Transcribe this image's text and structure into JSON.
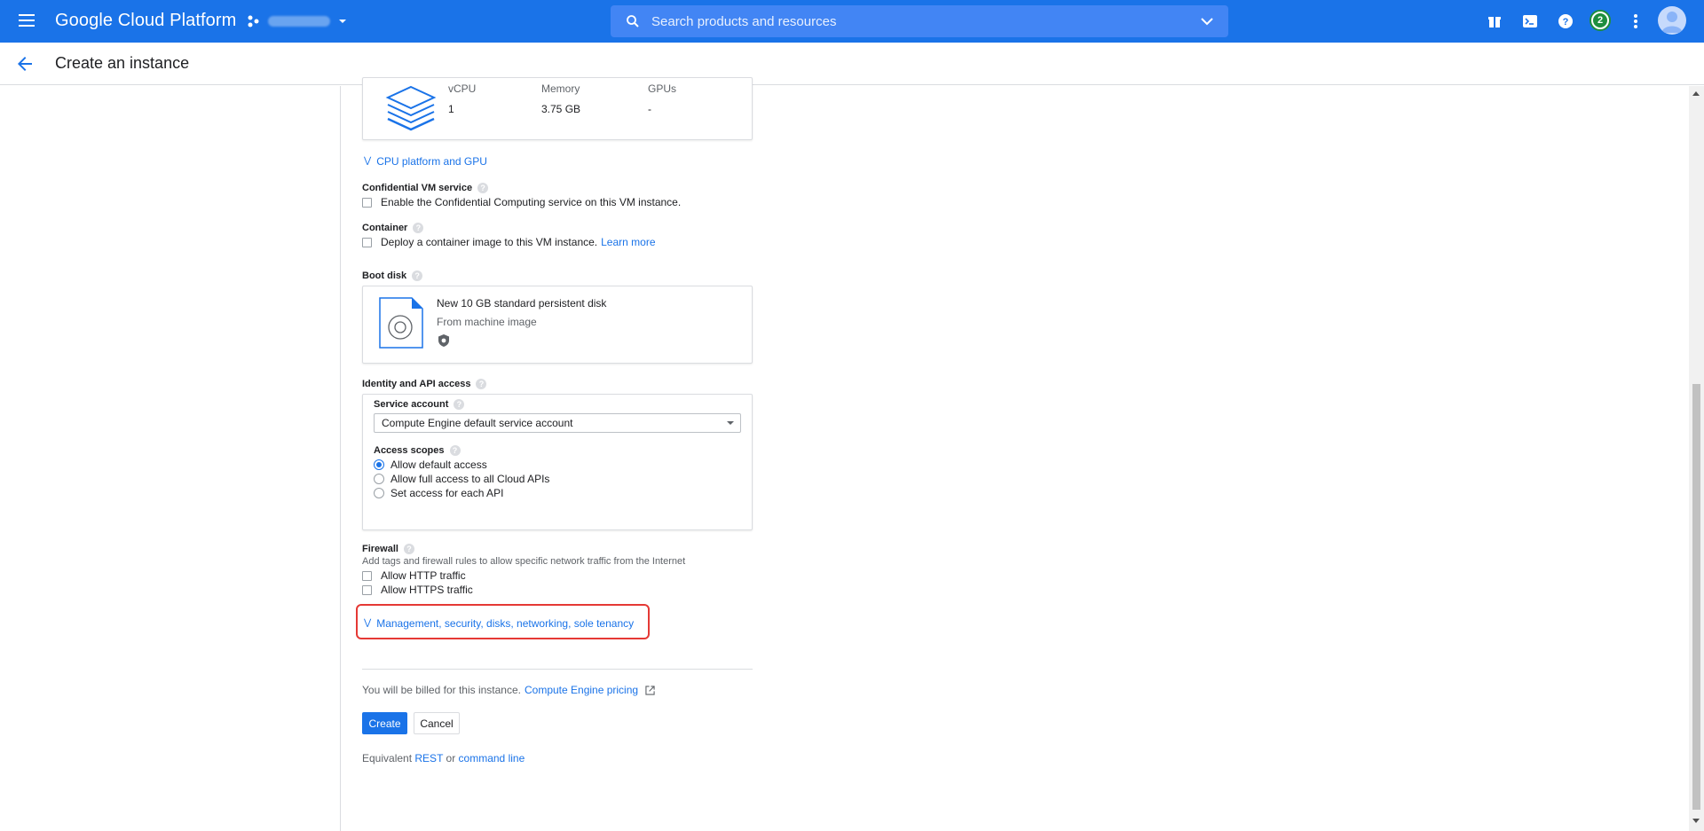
{
  "topbar": {
    "brand": "Google Cloud Platform",
    "search_placeholder": "Search products and resources",
    "notification_count": "2",
    "accent": "#1a73e8"
  },
  "subheader": {
    "title": "Create an instance"
  },
  "machine_summary": {
    "headers": [
      "vCPU",
      "Memory",
      "GPUs"
    ],
    "values": [
      "1",
      "3.75 GB",
      "-"
    ]
  },
  "cpu_platform": {
    "label": "CPU platform and GPU"
  },
  "confidential_vm": {
    "label": "Confidential VM service",
    "checkbox_label": "Enable the Confidential Computing service on this VM instance.",
    "checked": false
  },
  "container": {
    "label": "Container",
    "checkbox_label": "Deploy a container image to this VM instance.",
    "learn_more": "Learn more",
    "checked": false
  },
  "boot_disk": {
    "label": "Boot disk",
    "title": "New 10 GB standard persistent disk",
    "subtitle": "From machine image"
  },
  "identity": {
    "label": "Identity and API access",
    "service_account_label": "Service account",
    "service_account_value": "Compute Engine default service account",
    "access_scopes_label": "Access scopes",
    "scopes": [
      {
        "label": "Allow default access",
        "selected": true
      },
      {
        "label": "Allow full access to all Cloud APIs",
        "selected": false
      },
      {
        "label": "Set access for each API",
        "selected": false
      }
    ]
  },
  "firewall": {
    "label": "Firewall",
    "description": "Add tags and firewall rules to allow specific network traffic from the Internet",
    "http": "Allow HTTP traffic",
    "https": "Allow HTTPS traffic"
  },
  "advanced": {
    "label": "Management, security, disks, networking, sole tenancy"
  },
  "billing": {
    "text": "You will be billed for this instance.",
    "link": "Compute Engine pricing"
  },
  "actions": {
    "create": "Create",
    "cancel": "Cancel"
  },
  "equivalent": {
    "prefix": "Equivalent",
    "rest": "REST",
    "or": "or",
    "cli": "command line"
  }
}
